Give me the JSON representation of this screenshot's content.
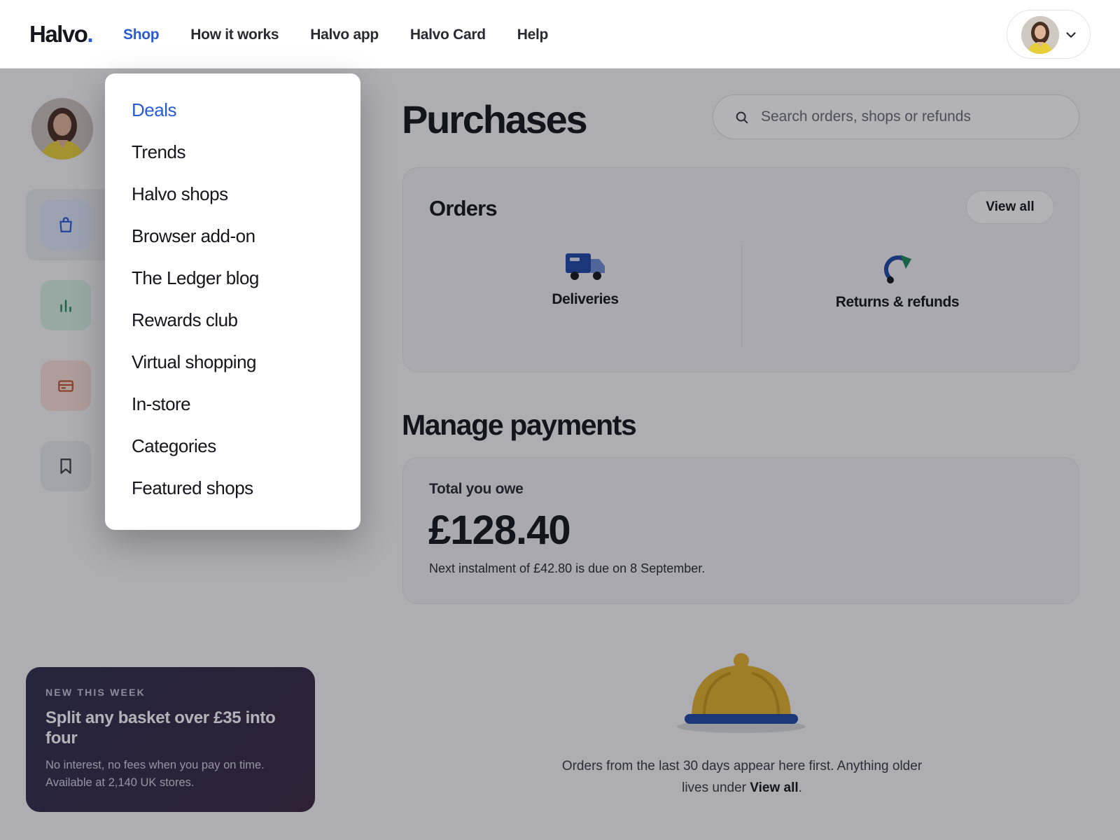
{
  "brand": {
    "name": "Halvo",
    "dot": "."
  },
  "nav": {
    "items": [
      {
        "label": "Shop"
      },
      {
        "label": "How it works"
      },
      {
        "label": "Halvo app"
      },
      {
        "label": "Halvo Card"
      },
      {
        "label": "Help"
      }
    ],
    "active": "Shop"
  },
  "shop_menu": {
    "items": [
      {
        "label": "Deals"
      },
      {
        "label": "Trends"
      },
      {
        "label": "Halvo shops"
      },
      {
        "label": "Browser add-on"
      },
      {
        "label": "The Ledger blog"
      },
      {
        "label": "Rewards club"
      },
      {
        "label": "Virtual shopping"
      },
      {
        "label": "In-store"
      },
      {
        "label": "Categories"
      },
      {
        "label": "Featured shops"
      }
    ],
    "active": "Deals"
  },
  "sidebar": {
    "items": [
      {
        "icon": "shopping-bag-icon",
        "color": "#2a5bd7"
      },
      {
        "icon": "bar-chart-icon",
        "color": "#1f8a5b"
      },
      {
        "icon": "credit-card-icon",
        "color": "#c0562e"
      },
      {
        "icon": "bookmark-icon",
        "color": "#3a3a44"
      }
    ]
  },
  "promo": {
    "tag": "NEW THIS WEEK",
    "title": "Split any basket over £35 into four",
    "description": "No interest, no fees when you pay on time. Available at 2,140 UK stores."
  },
  "page": {
    "title": "Purchases"
  },
  "search": {
    "placeholder": "Search orders, shops or refunds"
  },
  "orders": {
    "title": "Orders",
    "view_all": "View all",
    "options": [
      {
        "label": "Deliveries",
        "icon": "truck-icon"
      },
      {
        "label": "Returns & refunds",
        "icon": "refund-arrow-icon"
      }
    ]
  },
  "payments": {
    "section_title": "Manage payments",
    "total_label": "Total you owe",
    "total_amount": "£128.40",
    "next_instalment": "Next instalment of £42.80 is due on 8 September."
  },
  "empty_state": {
    "icon": "service-bell-icon",
    "text_before": "Orders from the last 30 days appear here first. Anything older lives under ",
    "link": "View all",
    "text_after": "."
  },
  "colors": {
    "accent": "#2a5bd7",
    "text": "#16161d"
  }
}
